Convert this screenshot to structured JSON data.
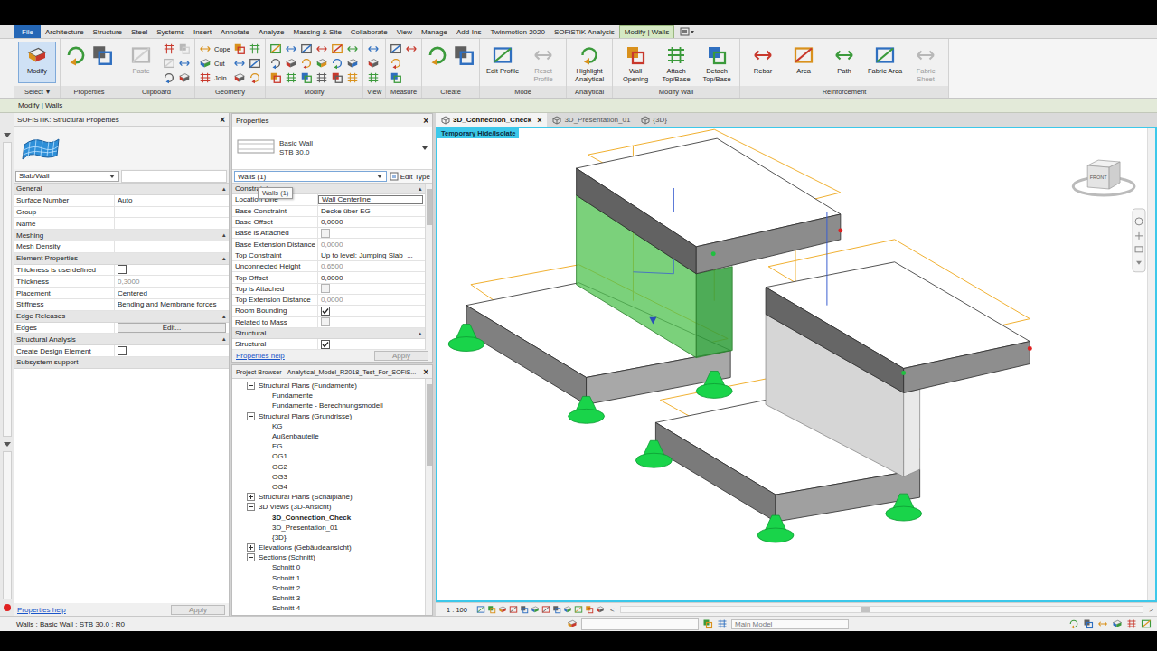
{
  "tabs": [
    {
      "label": "File",
      "selected": false,
      "kind": "file"
    },
    {
      "label": "Architecture",
      "selected": false,
      "kind": "tab"
    },
    {
      "label": "Structure",
      "selected": false,
      "kind": "tab"
    },
    {
      "label": "Steel",
      "selected": false,
      "kind": "tab"
    },
    {
      "label": "Systems",
      "selected": false,
      "kind": "tab"
    },
    {
      "label": "Insert",
      "selected": false,
      "kind": "tab"
    },
    {
      "label": "Annotate",
      "selected": false,
      "kind": "tab"
    },
    {
      "label": "Analyze",
      "selected": false,
      "kind": "tab"
    },
    {
      "label": "Massing & Site",
      "selected": false,
      "kind": "tab"
    },
    {
      "label": "Collaborate",
      "selected": false,
      "kind": "tab"
    },
    {
      "label": "View",
      "selected": false,
      "kind": "tab"
    },
    {
      "label": "Manage",
      "selected": false,
      "kind": "tab"
    },
    {
      "label": "Add-Ins",
      "selected": false,
      "kind": "tab"
    },
    {
      "label": "Twinmotion 2020",
      "selected": false,
      "kind": "tab"
    },
    {
      "label": "SOFiSTiK Analysis",
      "selected": false,
      "kind": "tab"
    },
    {
      "label": "Modify | Walls",
      "selected": true,
      "kind": "context"
    }
  ],
  "ribbon": [
    {
      "title": "Select",
      "menu": "▾",
      "groups": [
        {
          "kind": "large",
          "label": "Modify",
          "selected": true,
          "disabled": false
        }
      ]
    },
    {
      "title": "Properties",
      "groups": [
        {
          "kind": "bigicon",
          "disabled": false
        },
        {
          "kind": "bigicon",
          "disabled": false
        }
      ]
    },
    {
      "title": "Clipboard",
      "groups": [
        {
          "kind": "large",
          "label": "Paste",
          "selected": false,
          "disabled": true
        },
        {
          "kind": "stack",
          "items": [
            {
              "kind": "icon",
              "disabled": false
            },
            {
              "kind": "icon",
              "disabled": true
            },
            {
              "kind": "icon",
              "disabled": false
            },
            {
              "kind": "icon",
              "disabled": true
            },
            {
              "kind": "icon",
              "disabled": false
            },
            {
              "kind": "icon",
              "disabled": false
            }
          ]
        }
      ]
    },
    {
      "title": "Geometry",
      "groups": [
        {
          "kind": "stack",
          "items": [
            {
              "kind": "small",
              "label": "Cope",
              "disabled": false
            },
            {
              "kind": "small",
              "label": "Cut",
              "disabled": false
            },
            {
              "kind": "small",
              "label": "Join",
              "disabled": false
            }
          ]
        },
        {
          "kind": "stack",
          "items": [
            {
              "kind": "icon",
              "disabled": false
            },
            {
              "kind": "icon",
              "disabled": false
            },
            {
              "kind": "icon",
              "disabled": false
            },
            {
              "kind": "icon",
              "disabled": false
            },
            {
              "kind": "icon",
              "disabled": false
            },
            {
              "kind": "icon",
              "disabled": false
            }
          ]
        }
      ]
    },
    {
      "title": "Modify",
      "groups": [
        {
          "kind": "stack",
          "items": [
            {
              "kind": "icon",
              "disabled": false
            },
            {
              "kind": "icon",
              "disabled": false
            },
            {
              "kind": "icon",
              "disabled": false
            },
            {
              "kind": "icon",
              "disabled": false
            },
            {
              "kind": "icon",
              "disabled": false
            },
            {
              "kind": "icon",
              "disabled": false
            },
            {
              "kind": "icon",
              "disabled": false
            },
            {
              "kind": "icon",
              "disabled": false
            },
            {
              "kind": "icon",
              "disabled": false
            },
            {
              "kind": "icon",
              "disabled": false
            },
            {
              "kind": "icon",
              "disabled": false
            },
            {
              "kind": "icon",
              "disabled": false
            },
            {
              "kind": "icon",
              "disabled": false
            },
            {
              "kind": "icon",
              "disabled": false
            },
            {
              "kind": "icon",
              "disabled": false
            },
            {
              "kind": "icon",
              "disabled": false
            },
            {
              "kind": "icon",
              "disabled": false
            },
            {
              "kind": "icon",
              "disabled": false
            }
          ]
        }
      ]
    },
    {
      "title": "View",
      "groups": [
        {
          "kind": "stack",
          "items": [
            {
              "kind": "icon",
              "disabled": false
            },
            {
              "kind": "icon",
              "disabled": false
            },
            {
              "kind": "icon",
              "disabled": false
            }
          ]
        }
      ]
    },
    {
      "title": "Measure",
      "groups": [
        {
          "kind": "stack",
          "items": [
            {
              "kind": "icon",
              "disabled": false
            },
            {
              "kind": "icon",
              "disabled": false
            },
            {
              "kind": "icon",
              "disabled": false
            },
            {
              "kind": "icon",
              "disabled": false
            }
          ]
        }
      ]
    },
    {
      "title": "Create",
      "groups": [
        {
          "kind": "bigicon",
          "disabled": false
        },
        {
          "kind": "bigicon",
          "disabled": false
        }
      ]
    },
    {
      "title": "Mode",
      "groups": [
        {
          "kind": "large",
          "label": "Edit Profile",
          "selected": false,
          "disabled": false
        },
        {
          "kind": "large",
          "label": "Reset Profile",
          "selected": false,
          "disabled": true
        }
      ]
    },
    {
      "title": "Analytical",
      "groups": [
        {
          "kind": "large",
          "label": "Highlight Analytical",
          "selected": false,
          "disabled": false
        }
      ]
    },
    {
      "title": "Modify Wall",
      "groups": [
        {
          "kind": "large",
          "label": "Wall Opening",
          "selected": false,
          "disabled": false
        },
        {
          "kind": "large",
          "label": "Attach Top/Base",
          "selected": false,
          "disabled": false
        },
        {
          "kind": "large",
          "label": "Detach Top/Base",
          "selected": false,
          "disabled": false
        }
      ]
    },
    {
      "title": "Reinforcement",
      "groups": [
        {
          "kind": "large",
          "label": "Rebar",
          "selected": false,
          "disabled": false
        },
        {
          "kind": "large",
          "label": "Area",
          "selected": false,
          "disabled": false
        },
        {
          "kind": "large",
          "label": "Path",
          "selected": false,
          "disabled": false
        },
        {
          "kind": "large",
          "label": "Fabric Area",
          "selected": false,
          "disabled": false
        },
        {
          "kind": "large",
          "label": "Fabric Sheet",
          "selected": false,
          "disabled": true
        }
      ]
    }
  ],
  "options_bar": "Modify | Walls",
  "sofistik": {
    "title": "SOFiSTiK: Structural Properties",
    "close": "×",
    "type": "Slab/Wall",
    "sections": [
      {
        "title": "General",
        "toggle": "▴",
        "rows": [
          {
            "label": "Surface Number",
            "kind": "text",
            "value": "Auto",
            "disabled": false
          },
          {
            "label": "Group",
            "kind": "text",
            "value": "",
            "disabled": false
          },
          {
            "label": "Name",
            "kind": "text",
            "value": "",
            "disabled": false
          }
        ]
      },
      {
        "title": "Meshing",
        "toggle": "▴",
        "rows": [
          {
            "label": "Mesh Density",
            "kind": "text",
            "value": "",
            "disabled": false
          }
        ]
      },
      {
        "title": "Element Properties",
        "toggle": "▴",
        "rows": [
          {
            "label": "Thickness is userdefined",
            "kind": "checkbox",
            "checked": false,
            "disabled": false
          },
          {
            "label": "Thickness",
            "kind": "text",
            "value": "0,3000",
            "disabled": true
          },
          {
            "label": "Placement",
            "kind": "text",
            "value": "Centered",
            "disabled": false
          },
          {
            "label": "Stiffness",
            "kind": "text",
            "value": "Bending and Membrane forces",
            "disabled": false
          }
        ]
      },
      {
        "title": "Edge Releases",
        "toggle": "▴",
        "rows": [
          {
            "label": "Edges",
            "kind": "button",
            "value": "Edit...",
            "disabled": false
          }
        ]
      },
      {
        "title": "Structural Analysis",
        "toggle": "▴",
        "rows": [
          {
            "label": "Create Design Element",
            "kind": "checkbox",
            "checked": false,
            "disabled": false
          }
        ]
      },
      {
        "title": "Subsystem support",
        "toggle": "",
        "rows": []
      }
    ],
    "help": "Properties help",
    "apply": "Apply",
    "apply_disabled": true
  },
  "properties": {
    "title": "Properties",
    "close": "×",
    "type_name": "Basic Wall",
    "type_sub": "STB 30.0",
    "selector": "Walls (1)",
    "edit_type": "Edit Type",
    "tooltip": "Walls (1)",
    "sections": [
      {
        "title": "Constraints",
        "toggle": "▴",
        "rows": [
          {
            "label": "Location Line",
            "kind": "field",
            "value": "Wall Centerline",
            "disabled": false
          },
          {
            "label": "Base Constraint",
            "kind": "text",
            "value": "Decke über EG",
            "disabled": false
          },
          {
            "label": "Base Offset",
            "kind": "text",
            "value": "0,0000",
            "disabled": false
          },
          {
            "label": "Base is Attached",
            "kind": "checkbox",
            "checked": false,
            "disabled": true
          },
          {
            "label": "Base Extension Distance",
            "kind": "text",
            "value": "0,0000",
            "disabled": true
          },
          {
            "label": "Top Constraint",
            "kind": "text",
            "value": "Up to level: Jumping Slab_...",
            "disabled": false
          },
          {
            "label": "Unconnected Height",
            "kind": "text",
            "value": "0,6500",
            "disabled": true
          },
          {
            "label": "Top Offset",
            "kind": "text",
            "value": "0,0000",
            "disabled": false
          },
          {
            "label": "Top is Attached",
            "kind": "checkbox",
            "checked": false,
            "disabled": true
          },
          {
            "label": "Top Extension Distance",
            "kind": "text",
            "value": "0,0000",
            "disabled": true
          },
          {
            "label": "Room Bounding",
            "kind": "checkbox",
            "checked": true,
            "disabled": false
          },
          {
            "label": "Related to Mass",
            "kind": "checkbox",
            "checked": false,
            "disabled": true
          }
        ]
      },
      {
        "title": "Structural",
        "toggle": "▴",
        "rows": [
          {
            "label": "Structural",
            "kind": "checkbox",
            "checked": true,
            "disabled": false
          }
        ]
      }
    ],
    "help": "Properties help",
    "apply": "Apply",
    "apply_disabled": true
  },
  "browser": {
    "title": "Project Browser - Analytical_Model_R2018_Test_For_SOFiS...",
    "close": "×",
    "tree": [
      {
        "label": "Structural Plans (Fundamente)",
        "expanded": true,
        "children": [
          {
            "label": "Fundamente",
            "selected": false
          },
          {
            "label": "Fundamente - Berechnungsmodell",
            "selected": false
          }
        ]
      },
      {
        "label": "Structural Plans (Grundrisse)",
        "expanded": true,
        "children": [
          {
            "label": "KG",
            "selected": false
          },
          {
            "label": "Außenbauteile",
            "selected": false
          },
          {
            "label": "EG",
            "selected": false
          },
          {
            "label": "OG1",
            "selected": false
          },
          {
            "label": "OG2",
            "selected": false
          },
          {
            "label": "OG3",
            "selected": false
          },
          {
            "label": "OG4",
            "selected": false
          }
        ]
      },
      {
        "label": "Structural Plans (Schalpläne)",
        "expanded": false,
        "children": []
      },
      {
        "label": "3D Views (3D-Ansicht)",
        "expanded": true,
        "children": [
          {
            "label": "3D_Connection_Check",
            "selected": true
          },
          {
            "label": "3D_Presentation_01",
            "selected": false
          },
          {
            "label": "{3D}",
            "selected": false
          }
        ]
      },
      {
        "label": "Elevations (Gebäudeansicht)",
        "expanded": false,
        "children": []
      },
      {
        "label": "Sections (Schnitt)",
        "expanded": true,
        "children": [
          {
            "label": "Schnitt 0",
            "selected": false
          },
          {
            "label": "Schnitt 1",
            "selected": false
          },
          {
            "label": "Schnitt 2",
            "selected": false
          },
          {
            "label": "Schnitt 3",
            "selected": false
          },
          {
            "label": "Schnitt 4",
            "selected": false
          }
        ]
      }
    ]
  },
  "view_tabs": [
    {
      "label": "3D_Connection_Check",
      "selected": true,
      "close": "×"
    },
    {
      "label": "3D_Presentation_01",
      "selected": false,
      "close": ""
    },
    {
      "label": "{3D}",
      "selected": false,
      "close": ""
    }
  ],
  "viewport": {
    "badge": "Temporary Hide/Isolate",
    "viewcube": "FRONT"
  },
  "view_bar": {
    "scale": "1 : 100",
    "left": "<",
    "right": ">"
  },
  "status": {
    "text": "Walls : Basic Wall : STB 30.0 : R0",
    "model": "Main Model"
  }
}
